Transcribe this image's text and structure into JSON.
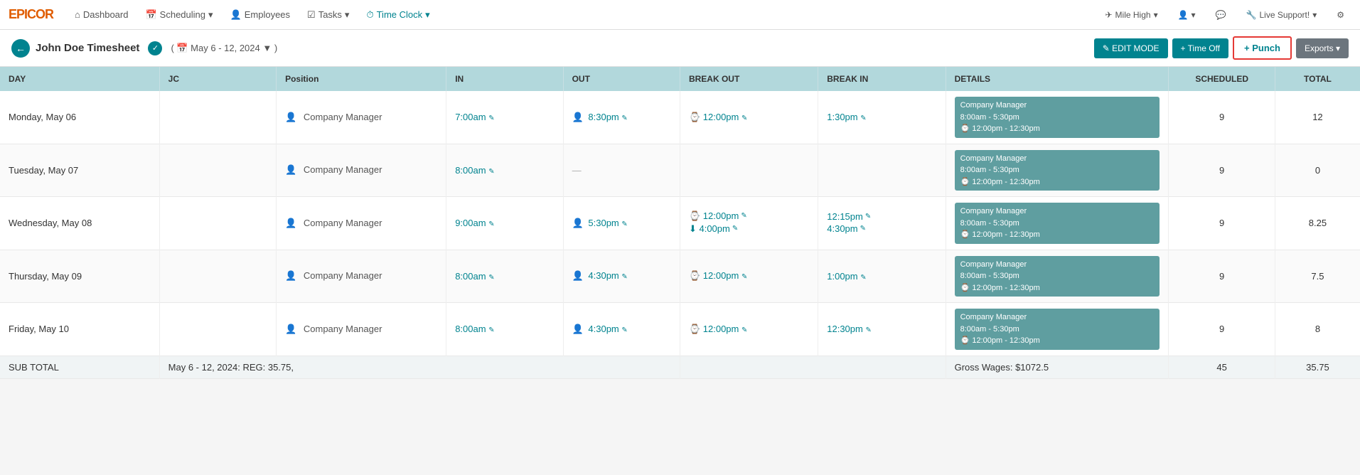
{
  "app": {
    "logo": "epicor",
    "logo_display": "EPICOR"
  },
  "nav": {
    "items": [
      {
        "id": "dashboard",
        "label": "Dashboard",
        "icon": "⌂",
        "active": false
      },
      {
        "id": "scheduling",
        "label": "Scheduling",
        "icon": "📅",
        "active": false,
        "dropdown": true
      },
      {
        "id": "employees",
        "label": "Employees",
        "icon": "👤",
        "active": false
      },
      {
        "id": "tasks",
        "label": "Tasks",
        "icon": "☑",
        "active": false,
        "dropdown": true
      },
      {
        "id": "timeclock",
        "label": "Time Clock",
        "icon": "⏱",
        "active": true,
        "dropdown": true
      }
    ],
    "right": [
      {
        "id": "location",
        "label": "Mile High",
        "icon": "✈",
        "dropdown": true
      },
      {
        "id": "user",
        "label": "",
        "icon": "👤",
        "dropdown": true
      },
      {
        "id": "messages",
        "label": "",
        "icon": "💬"
      },
      {
        "id": "support",
        "label": "Live Support!",
        "icon": "🔧",
        "dropdown": true
      },
      {
        "id": "settings",
        "label": "",
        "icon": "⚙"
      }
    ]
  },
  "subheader": {
    "back_label": "←",
    "title": "John Doe Timesheet",
    "verified_icon": "✓",
    "date_range": "( 📅 May 6 - 12, 2024 ▼ )",
    "buttons": {
      "edit_mode": "✎ EDIT MODE",
      "time_off": "+ Time Off",
      "punch": "+ Punch",
      "exports": "Exports ▾"
    }
  },
  "table": {
    "headers": [
      "DAY",
      "JC",
      "Position",
      "IN",
      "OUT",
      "BREAK OUT",
      "BREAK IN",
      "DETAILS",
      "SCHEDULED",
      "TOTAL"
    ],
    "rows": [
      {
        "day": "Monday, May 06",
        "jc": "",
        "position": "Company Manager",
        "in": "7:00am",
        "out": "8:30pm",
        "break_out": "⌚ 12:00pm",
        "break_in": "1:30pm",
        "details_line1": "Company Manager",
        "details_line2": "8:00am - 5:30pm",
        "details_line3": "⌚ 12:00pm - 12:30pm",
        "scheduled": "9",
        "total": "12"
      },
      {
        "day": "Tuesday, May 07",
        "jc": "",
        "position": "Company Manager",
        "in": "8:00am",
        "out": "—",
        "break_out": "",
        "break_in": "",
        "details_line1": "Company Manager",
        "details_line2": "8:00am - 5:30pm",
        "details_line3": "⌚ 12:00pm - 12:30pm",
        "scheduled": "9",
        "total": "0"
      },
      {
        "day": "Wednesday, May 08",
        "jc": "",
        "position": "Company Manager",
        "in": "9:00am",
        "out": "5:30pm",
        "break_out_1": "⌚ 12:00pm",
        "break_out_2": "⬇ 4:00pm",
        "break_in_1": "12:15pm",
        "break_in_2": "4:30pm",
        "details_line1": "Company Manager",
        "details_line2": "8:00am - 5:30pm",
        "details_line3": "⌚ 12:00pm - 12:30pm",
        "scheduled": "9",
        "total": "8.25"
      },
      {
        "day": "Thursday, May 09",
        "jc": "",
        "position": "Company Manager",
        "in": "8:00am",
        "out": "4:30pm",
        "break_out": "⌚ 12:00pm",
        "break_in": "1:00pm",
        "details_line1": "Company Manager",
        "details_line2": "8:00am - 5:30pm",
        "details_line3": "⌚ 12:00pm - 12:30pm",
        "scheduled": "9",
        "total": "7.5"
      },
      {
        "day": "Friday, May 10",
        "jc": "",
        "position": "Company Manager",
        "in": "8:00am",
        "out": "4:30pm",
        "break_out": "⌚ 12:00pm",
        "break_in": "12:30pm",
        "details_line1": "Company Manager",
        "details_line2": "8:00am - 5:30pm",
        "details_line3": "⌚ 12:00pm - 12:30pm",
        "scheduled": "9",
        "total": "8"
      }
    ],
    "subtotal": {
      "label": "SUB TOTAL",
      "jc_info": "May 6 - 12, 2024: REG: 35.75,",
      "gross_wages": "Gross Wages: $1072.5",
      "scheduled": "45",
      "total": "35.75"
    }
  },
  "colors": {
    "teal": "#00838f",
    "header_bg": "#b2d8dc",
    "details_bg": "#5f9ea0",
    "red_border": "#e53935"
  }
}
